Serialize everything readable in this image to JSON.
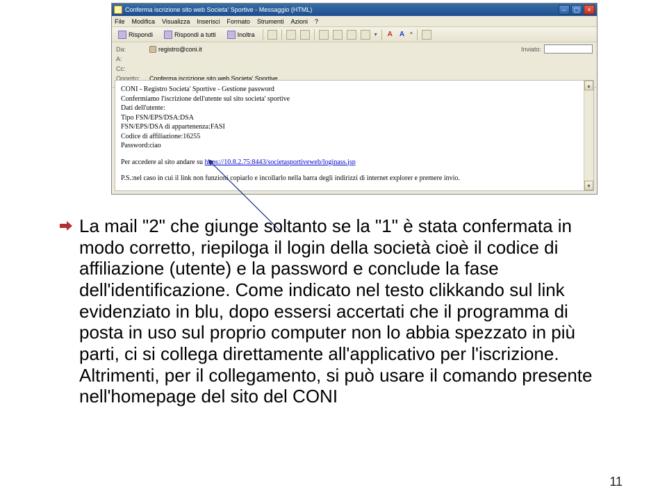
{
  "window": {
    "title": "Conferma iscrizione sito web Societa' Sportive - Messaggio (HTML)"
  },
  "menu": {
    "file": "File",
    "modifica": "Modifica",
    "visualizza": "Visualizza",
    "inserisci": "Inserisci",
    "formato": "Formato",
    "strumenti": "Strumenti",
    "azioni": "Azioni",
    "help": "?"
  },
  "toolbar": {
    "rispondi": "Rispondi",
    "rispondi_tutti": "Rispondi a tutti",
    "inoltra": "Inoltra",
    "aa": "A"
  },
  "headers": {
    "da_label": "Da:",
    "da_value": "registro@coni.it",
    "a_label": "A:",
    "cc_label": "Cc:",
    "oggetto_label": "Oggetto:",
    "oggetto_value": "Conferma iscrizione sito web Societa' Sportive",
    "inviato_label": "Inviato:"
  },
  "bodylines": {
    "l1": "CONI - Registro Societa' Sportive - Gestione password",
    "l2": "Confermiamo l'iscrizione dell'utente sul sito societa' sportive",
    "l3": "Dati dell'utente:",
    "l4": "Tipo FSN/EPS/DSA:DSA",
    "l5": "FSN/EPS/DSA di appartenenza:FASI",
    "l6": "Codice di affiliazione:16255",
    "l7": "Password:ciao",
    "l8a": "Per accedere al sito andare su ",
    "l8link": "https://10.8.2.75:8443/societasportiveweb/loginass.jsp",
    "l9": "P.S.:nel caso in cui il link non funzioni copiarlo e incollarlo nella barra degli indirizzi di internet explorer e premere invio."
  },
  "main_paragraph": "La mail \"2\" che giunge soltanto se la \"1\" è stata confermata in modo corretto, riepiloga il login della società cioè il codice di affiliazione (utente) e la password e conclude la fase dell'identificazione. Come indicato nel testo clikkando sul link evidenziato in blu, dopo essersi accertati che il programma di posta in uso sul proprio computer non lo abbia spezzato in più parti, ci si collega direttamente all'applicativo per l'iscrizione. Altrimenti, per il collegamento, si può usare il comando presente nell'homepage del sito del CONI",
  "page_number": "11"
}
